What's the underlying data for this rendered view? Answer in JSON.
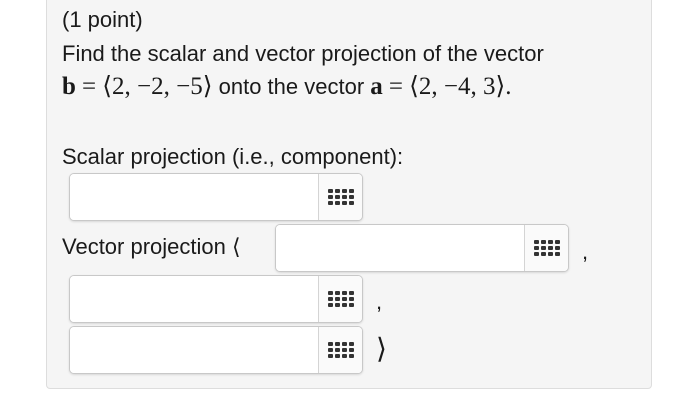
{
  "problem": {
    "points": "(1 point)",
    "prompt": "Find the scalar and vector projection of the vector",
    "vector_b_name": "b",
    "equals": "=",
    "vector_b_value": "⟨2, −2, −5⟩",
    "onto_text": "onto the vector",
    "vector_a_name": "a",
    "vector_a_value": "⟨2, −4, 3⟩.",
    "scalar_label": "Scalar projection (i.e., component):",
    "vector_label": "Vector projection ⟨",
    "comma": ",",
    "close_angle": "⟩"
  },
  "inputs": {
    "scalar": "",
    "vector_1": "",
    "vector_2": "",
    "vector_3": ""
  },
  "icons": {
    "equation_editor": "grid-keypad-icon"
  }
}
